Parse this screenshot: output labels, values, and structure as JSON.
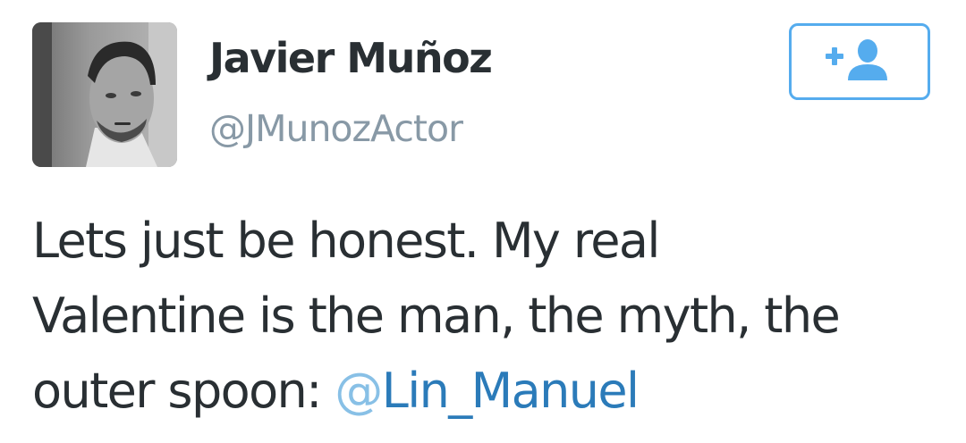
{
  "user": {
    "display_name": "Javier Muñoz",
    "handle": "@JMunozActor",
    "avatar": "profile-photo"
  },
  "follow_button": {
    "icon": "follow-user-icon",
    "accent_color": "#55acee"
  },
  "tweet": {
    "text_line_1": "Lets just be honest. My real",
    "text_line_2": "Valentine is the man, the myth, the",
    "text_line_3_prefix": "outer spoon: ",
    "mention_at": "@",
    "mention_name": "Lin_Manuel",
    "mention_color": "#2b7bb9"
  }
}
